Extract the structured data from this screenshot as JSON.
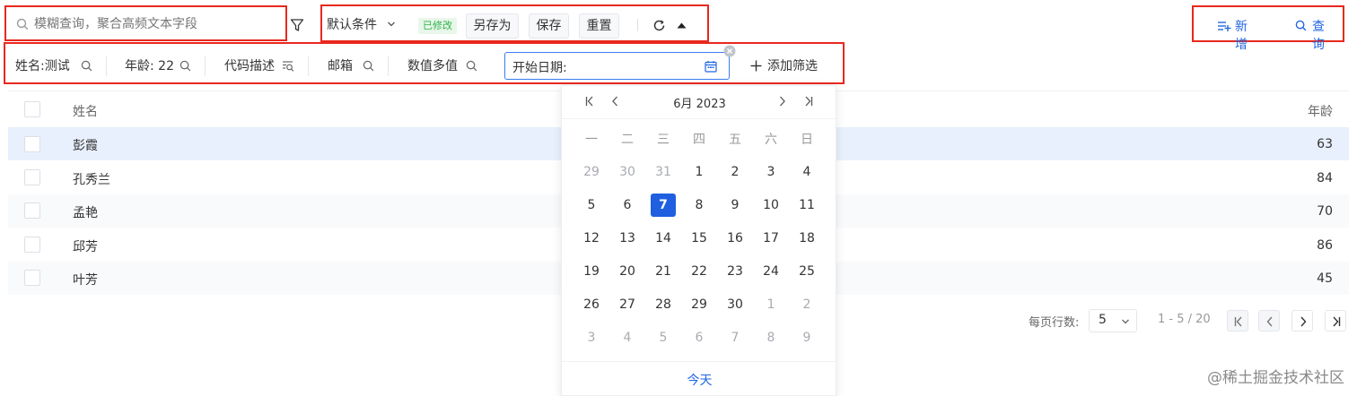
{
  "toolbar": {
    "search_placeholder": "模糊查询，聚合高频文本字段",
    "condition_label": "默认条件",
    "modified_badge": "已修改",
    "save_as_label": "另存为",
    "save_label": "保存",
    "reset_label": "重置",
    "add_label": "新增",
    "query_label": "查询"
  },
  "filters": {
    "name_label": "姓名:",
    "name_value": "测试",
    "age_label": "年龄:",
    "age_value": "22",
    "code_label": "代码描述",
    "email_label": "邮箱",
    "multi_label": "数值多值",
    "start_date_label": "开始日期:",
    "add_filter_label": "添加筛选"
  },
  "table": {
    "headers": {
      "name": "姓名",
      "age": "年龄"
    },
    "rows": [
      {
        "name": "彭霞",
        "age": "63"
      },
      {
        "name": "孔秀兰",
        "age": "84"
      },
      {
        "name": "孟艳",
        "age": "70"
      },
      {
        "name": "邱芳",
        "age": "86"
      },
      {
        "name": "叶芳",
        "age": "45"
      }
    ]
  },
  "pagination": {
    "rows_per_page_label": "每页行数:",
    "rows_per_page_value": "5",
    "range_text": "1 - 5 / 20"
  },
  "calendar": {
    "title": "6月 2023",
    "weekdays": [
      "一",
      "二",
      "三",
      "四",
      "五",
      "六",
      "日"
    ],
    "weeks": [
      [
        "29",
        "30",
        "31",
        "1",
        "2",
        "3",
        "4"
      ],
      [
        "5",
        "6",
        "7",
        "8",
        "9",
        "10",
        "11"
      ],
      [
        "12",
        "13",
        "14",
        "15",
        "16",
        "17",
        "18"
      ],
      [
        "19",
        "20",
        "21",
        "22",
        "23",
        "24",
        "25"
      ],
      [
        "26",
        "27",
        "28",
        "29",
        "30",
        "1",
        "2"
      ],
      [
        "3",
        "4",
        "5",
        "6",
        "7",
        "8",
        "9"
      ]
    ],
    "selected_day": "7",
    "today_label": "今天"
  },
  "colors": {
    "accent": "#1f5fe0",
    "highlight_box": "#e8281e",
    "selected_row": "#e9f0fd",
    "modified_badge_bg": "#e8f7ea"
  },
  "watermark": "@稀土掘金技术社区"
}
